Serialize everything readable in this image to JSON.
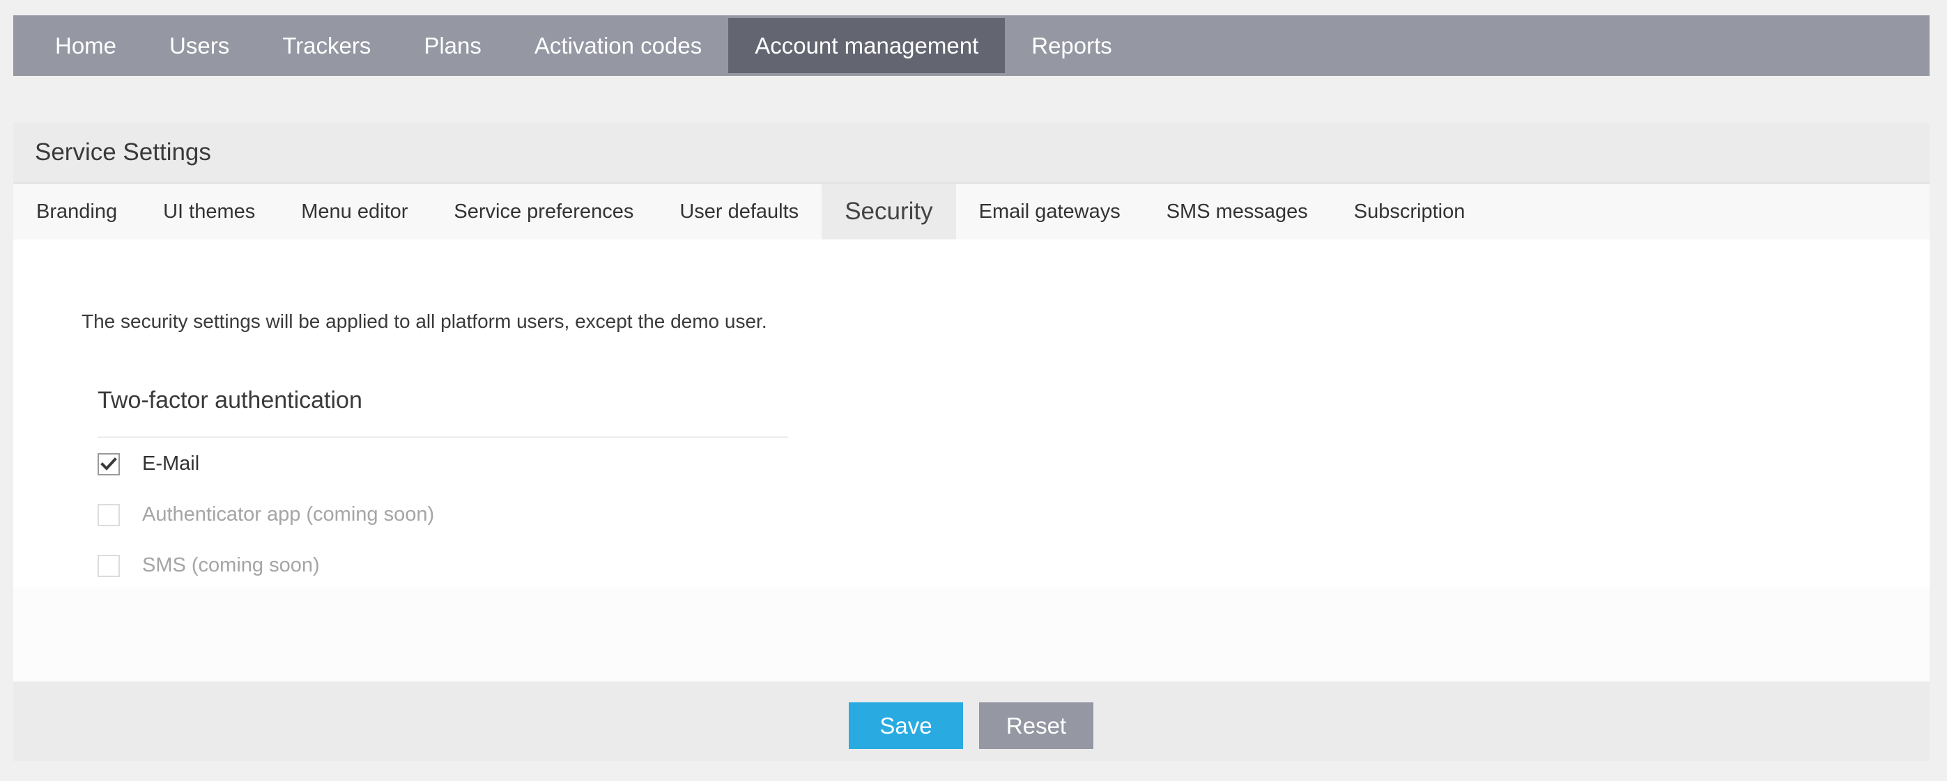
{
  "nav": {
    "items": [
      {
        "label": "Home"
      },
      {
        "label": "Users"
      },
      {
        "label": "Trackers"
      },
      {
        "label": "Plans"
      },
      {
        "label": "Activation codes"
      },
      {
        "label": "Account management",
        "active": true
      },
      {
        "label": "Reports"
      }
    ]
  },
  "panel": {
    "title": "Service Settings",
    "tabs": [
      {
        "label": "Branding"
      },
      {
        "label": "UI themes"
      },
      {
        "label": "Menu editor"
      },
      {
        "label": "Service preferences"
      },
      {
        "label": "User defaults"
      },
      {
        "label": "Security",
        "active": true
      },
      {
        "label": "Email gateways"
      },
      {
        "label": "SMS messages"
      },
      {
        "label": "Subscription"
      }
    ]
  },
  "security": {
    "intro": "The security settings will be applied to all platform users, except the demo user.",
    "two_factor_title": "Two-factor authentication",
    "options": [
      {
        "label": "E-Mail",
        "checked": true,
        "disabled": false
      },
      {
        "label": "Authenticator app (coming soon)",
        "checked": false,
        "disabled": true
      },
      {
        "label": "SMS (coming soon)",
        "checked": false,
        "disabled": true
      }
    ]
  },
  "footer": {
    "save_label": "Save",
    "reset_label": "Reset"
  },
  "colors": {
    "nav_bg": "#9597a3",
    "nav_active": "#636570",
    "save_button": "#29abe2",
    "reset_button": "#9597a3"
  },
  "icons": {
    "checkmark": "checkmark-icon"
  }
}
